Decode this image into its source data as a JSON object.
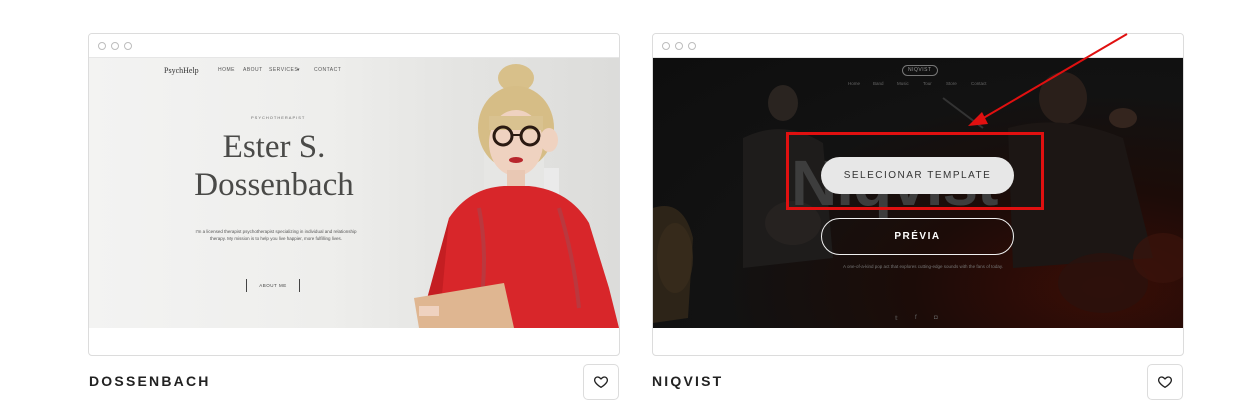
{
  "templates": [
    {
      "title": "DOSSENBACH",
      "preview": {
        "brand": "PsychHelp",
        "nav": [
          "HOME",
          "ABOUT",
          "SERVICES",
          "CONTACT"
        ],
        "eyebrow": "PSYCHOTHERAPIST",
        "name_line1": "Ester S.",
        "name_line2": "Dossenbach",
        "description": "I'm a licensed therapist psychotherapist specializing in individual and relationship therapy. My mission is to help you live happier, more fulfilling lives.",
        "button": "ABOUT ME"
      },
      "favorite_icon": "heart-outline-icon"
    },
    {
      "title": "NIQVIST",
      "preview": {
        "logo": "NIQVIST",
        "nav": [
          "Home",
          "Band",
          "Music",
          "Tour",
          "Store",
          "Contact"
        ],
        "big_word": "Niqvist",
        "tagline": "A one-of-a-kind pop act that explores cutting-edge sounds with the fans of today.",
        "social": [
          "twitter-icon",
          "facebook-icon",
          "instagram-icon"
        ]
      },
      "overlay": {
        "select_label": "SELECIONAR TEMPLATE",
        "preview_label": "PRÉVIA"
      },
      "favorite_icon": "heart-outline-icon"
    }
  ],
  "colors": {
    "annotation": "#e01010",
    "card_border": "#dcdcdc",
    "title_text": "#222222"
  }
}
